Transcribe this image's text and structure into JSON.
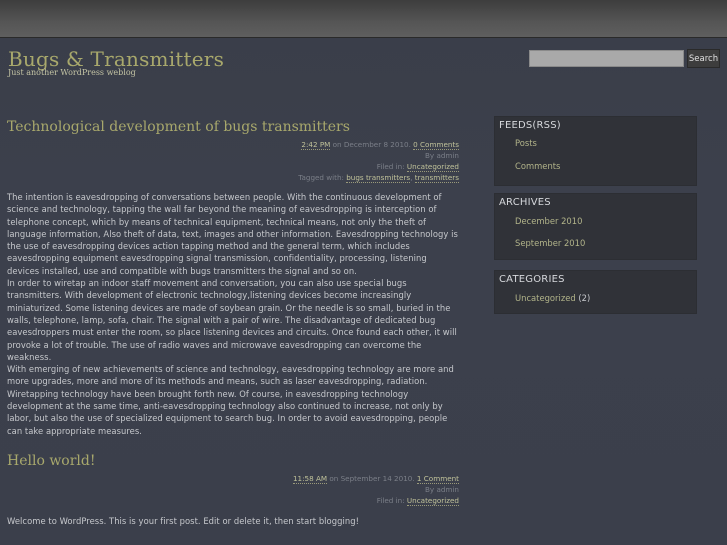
{
  "site": {
    "title": "Bugs & Transmitters",
    "description": "Just another WordPress weblog"
  },
  "search": {
    "value": "",
    "button_label": "Search"
  },
  "posts": [
    {
      "title": "Technological development of bugs transmitters",
      "time": "2:42 PM",
      "date_text": " on December 8 2010. ",
      "comments": "0 Comments",
      "author": "By admin",
      "filed_label": "Filed in: ",
      "category": "Uncategorized",
      "tagged_label": "Tagged with: ",
      "tags": [
        "bugs transmitters",
        "transmitters"
      ],
      "paragraphs": [
        "The intention is eavesdropping of conversations between people. With the continuous development of science and technology, tapping the wall far beyond the meaning of eavesdropping is interception of telephone concept, which by means of technical equipment, technical means, not only the theft of language information, Also theft of data, text, images and other information. Eavesdropping technology is the use of eavesdropping devices action tapping method and the general term, which includes eavesdropping equipment eavesdropping signal transmission, confidentiality, processing, listening devices installed, use and compatible with bugs transmitters the signal and so on.",
        "In order to wiretap an indoor staff movement and conversation, you can also use special bugs transmitters. With development of electronic technology,listening devices become increasingly miniaturized. Some listening devices are made of soybean grain. Or the needle is so small, buried in the walls, telephone, lamp, sofa, chair. The signal with a pair of wire. The disadvantage of dedicated bug eavesdroppers must enter the room, so place listening devices and circuits. Once found each other, it will provoke a lot of trouble. The use of radio waves and microwave eavesdropping can overcome the weakness.",
        "With emerging of new achievements of science and technology, eavesdropping technology are more and more upgrades, more and more of its methods and means, such as laser eavesdropping, radiation. Wiretapping technology have been brought forth new. Of course, in eavesdropping technology development at the same time, anti-eavesdropping technology also continued to increase, not only by labor, but also the use of specialized equipment to search bug. In order to avoid eavesdropping, people can take appropriate measures."
      ]
    },
    {
      "title": "Hello world!",
      "time": "11:58 AM",
      "date_text": " on September 14 2010. ",
      "comments": "1 Comment",
      "author": "By admin",
      "filed_label": "Filed in: ",
      "category": "Uncategorized",
      "paragraphs": [
        "Welcome to WordPress. This is your first post. Edit or delete it, then start blogging!"
      ]
    }
  ],
  "sidebar": {
    "feeds": {
      "title": "FEEDS(RSS)",
      "items": [
        "Posts",
        "Comments"
      ]
    },
    "archives": {
      "title": "ARCHIVES",
      "items": [
        "December 2010",
        "September 2010"
      ]
    },
    "categories": {
      "title": "CATEGORIES",
      "items": [
        {
          "name": "Uncategorized",
          "count": "(2)"
        }
      ]
    }
  }
}
